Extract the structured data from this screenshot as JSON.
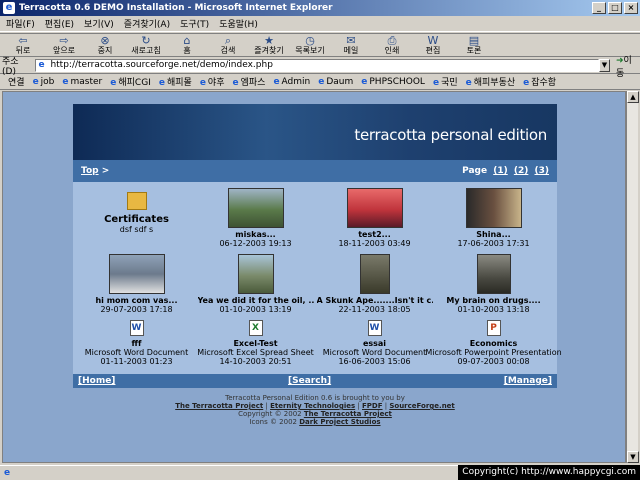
{
  "window": {
    "title": "Terracotta 0.6 DEMO Installation - Microsoft Internet Explorer"
  },
  "menu": [
    "파일(F)",
    "편집(E)",
    "보기(V)",
    "즐겨찾기(A)",
    "도구(T)",
    "도움말(H)"
  ],
  "toolbar": [
    {
      "icon": "back-icon",
      "label": "뒤로"
    },
    {
      "icon": "forward-icon",
      "label": "앞으로"
    },
    {
      "icon": "stop-icon",
      "label": "중지"
    },
    {
      "icon": "refresh-icon",
      "label": "새로고침"
    },
    {
      "icon": "home-icon",
      "label": "홈"
    },
    {
      "icon": "search-icon",
      "label": "검색"
    },
    {
      "icon": "favorites-icon",
      "label": "즐겨찾기"
    },
    {
      "icon": "history-icon",
      "label": "목록보기"
    },
    {
      "icon": "mail-icon",
      "label": "메일"
    },
    {
      "icon": "print-icon",
      "label": "인쇄"
    },
    {
      "icon": "edit-icon",
      "label": "편집"
    },
    {
      "icon": "discuss-icon",
      "label": "토론"
    }
  ],
  "address": {
    "label": "주소(D)",
    "url": "http://terracotta.sourceforge.net/demo/index.php",
    "go_label": "이동"
  },
  "links": {
    "label": "연결",
    "items": [
      "job",
      "master",
      "해피CGI",
      "해피몰",
      "야후",
      "엠파스",
      "Admin",
      "Daum",
      "PHPSCHOOL",
      "국민",
      "해피부동산",
      "잡수함"
    ]
  },
  "page": {
    "banner_title": "terracotta personal edition",
    "top_label": "Top",
    "top_sep": ">",
    "page_label": "Page",
    "pages": [
      "(1)",
      "(2)",
      "(3)"
    ],
    "rows": [
      [
        {
          "type": "folder",
          "title": "Certificates",
          "desc": "dsf sdf s"
        },
        {
          "type": "image",
          "thumb": "#5a7a4a",
          "title": "miskas...",
          "date": "06-12-2003 19:13"
        },
        {
          "type": "image",
          "thumb": "#c0343c",
          "title": "test2...",
          "date": "18-11-2003 03:49"
        },
        {
          "type": "image",
          "thumb": "#6a5040",
          "title": "Shina...",
          "date": "17-06-2003 17:31"
        }
      ],
      [
        {
          "type": "image",
          "thumb": "#6c7a8c",
          "title": "hi mom com vas...",
          "date": "29-07-2003 17:18"
        },
        {
          "type": "image",
          "thumb": "#7a8a6a",
          "title": "Yea we did it for the oil, ...",
          "date": "01-10-2003 13:19"
        },
        {
          "type": "image",
          "thumb": "#5a5a4a",
          "title": "A Skunk Ape.......Isn't it c...",
          "date": "22-11-2003 18:05"
        },
        {
          "type": "image",
          "thumb": "#4a4a42",
          "title": "My brain on drugs....",
          "date": "01-10-2003 13:18"
        }
      ],
      [
        {
          "type": "doc",
          "icon": "word-doc-icon",
          "glyph": "W",
          "color": "#1f4fa8",
          "title": "fff",
          "kind": "Microsoft Word Document",
          "date": "01-11-2003 01:23"
        },
        {
          "type": "doc",
          "icon": "excel-doc-icon",
          "glyph": "X",
          "color": "#1e7a2e",
          "title": "Excel-Test",
          "kind": "Microsoft Excel Spread Sheet",
          "date": "14-10-2003 20:51"
        },
        {
          "type": "doc",
          "icon": "word-doc-icon",
          "glyph": "W",
          "color": "#1f4fa8",
          "title": "essai",
          "kind": "Microsoft Word Document",
          "date": "16-06-2003 15:06"
        },
        {
          "type": "doc",
          "icon": "powerpoint-doc-icon",
          "glyph": "P",
          "color": "#c4411a",
          "title": "Economics",
          "kind": "Microsoft Powerpoint Presentation",
          "date": "09-07-2003 00:08"
        }
      ]
    ],
    "bottom": {
      "home": "[Home]",
      "search": "[Search]",
      "manage": "[Manage]"
    },
    "footer": {
      "line1": "Terracotta Personal Edition 0.6 is brought to you by",
      "links": [
        "The Terracotta Project",
        "Eternity Technologies",
        "FPDF",
        "SourceForge.net"
      ],
      "sep": "|",
      "copyright_prefix": "Copyright © 2002",
      "copyright_link": "The Terracotta Project",
      "icons_prefix": "Icons © 2002",
      "icons_link": "Dark Project Studios"
    }
  },
  "status": {
    "copyright": "Copyright(c) http://www.happycgi.com"
  }
}
